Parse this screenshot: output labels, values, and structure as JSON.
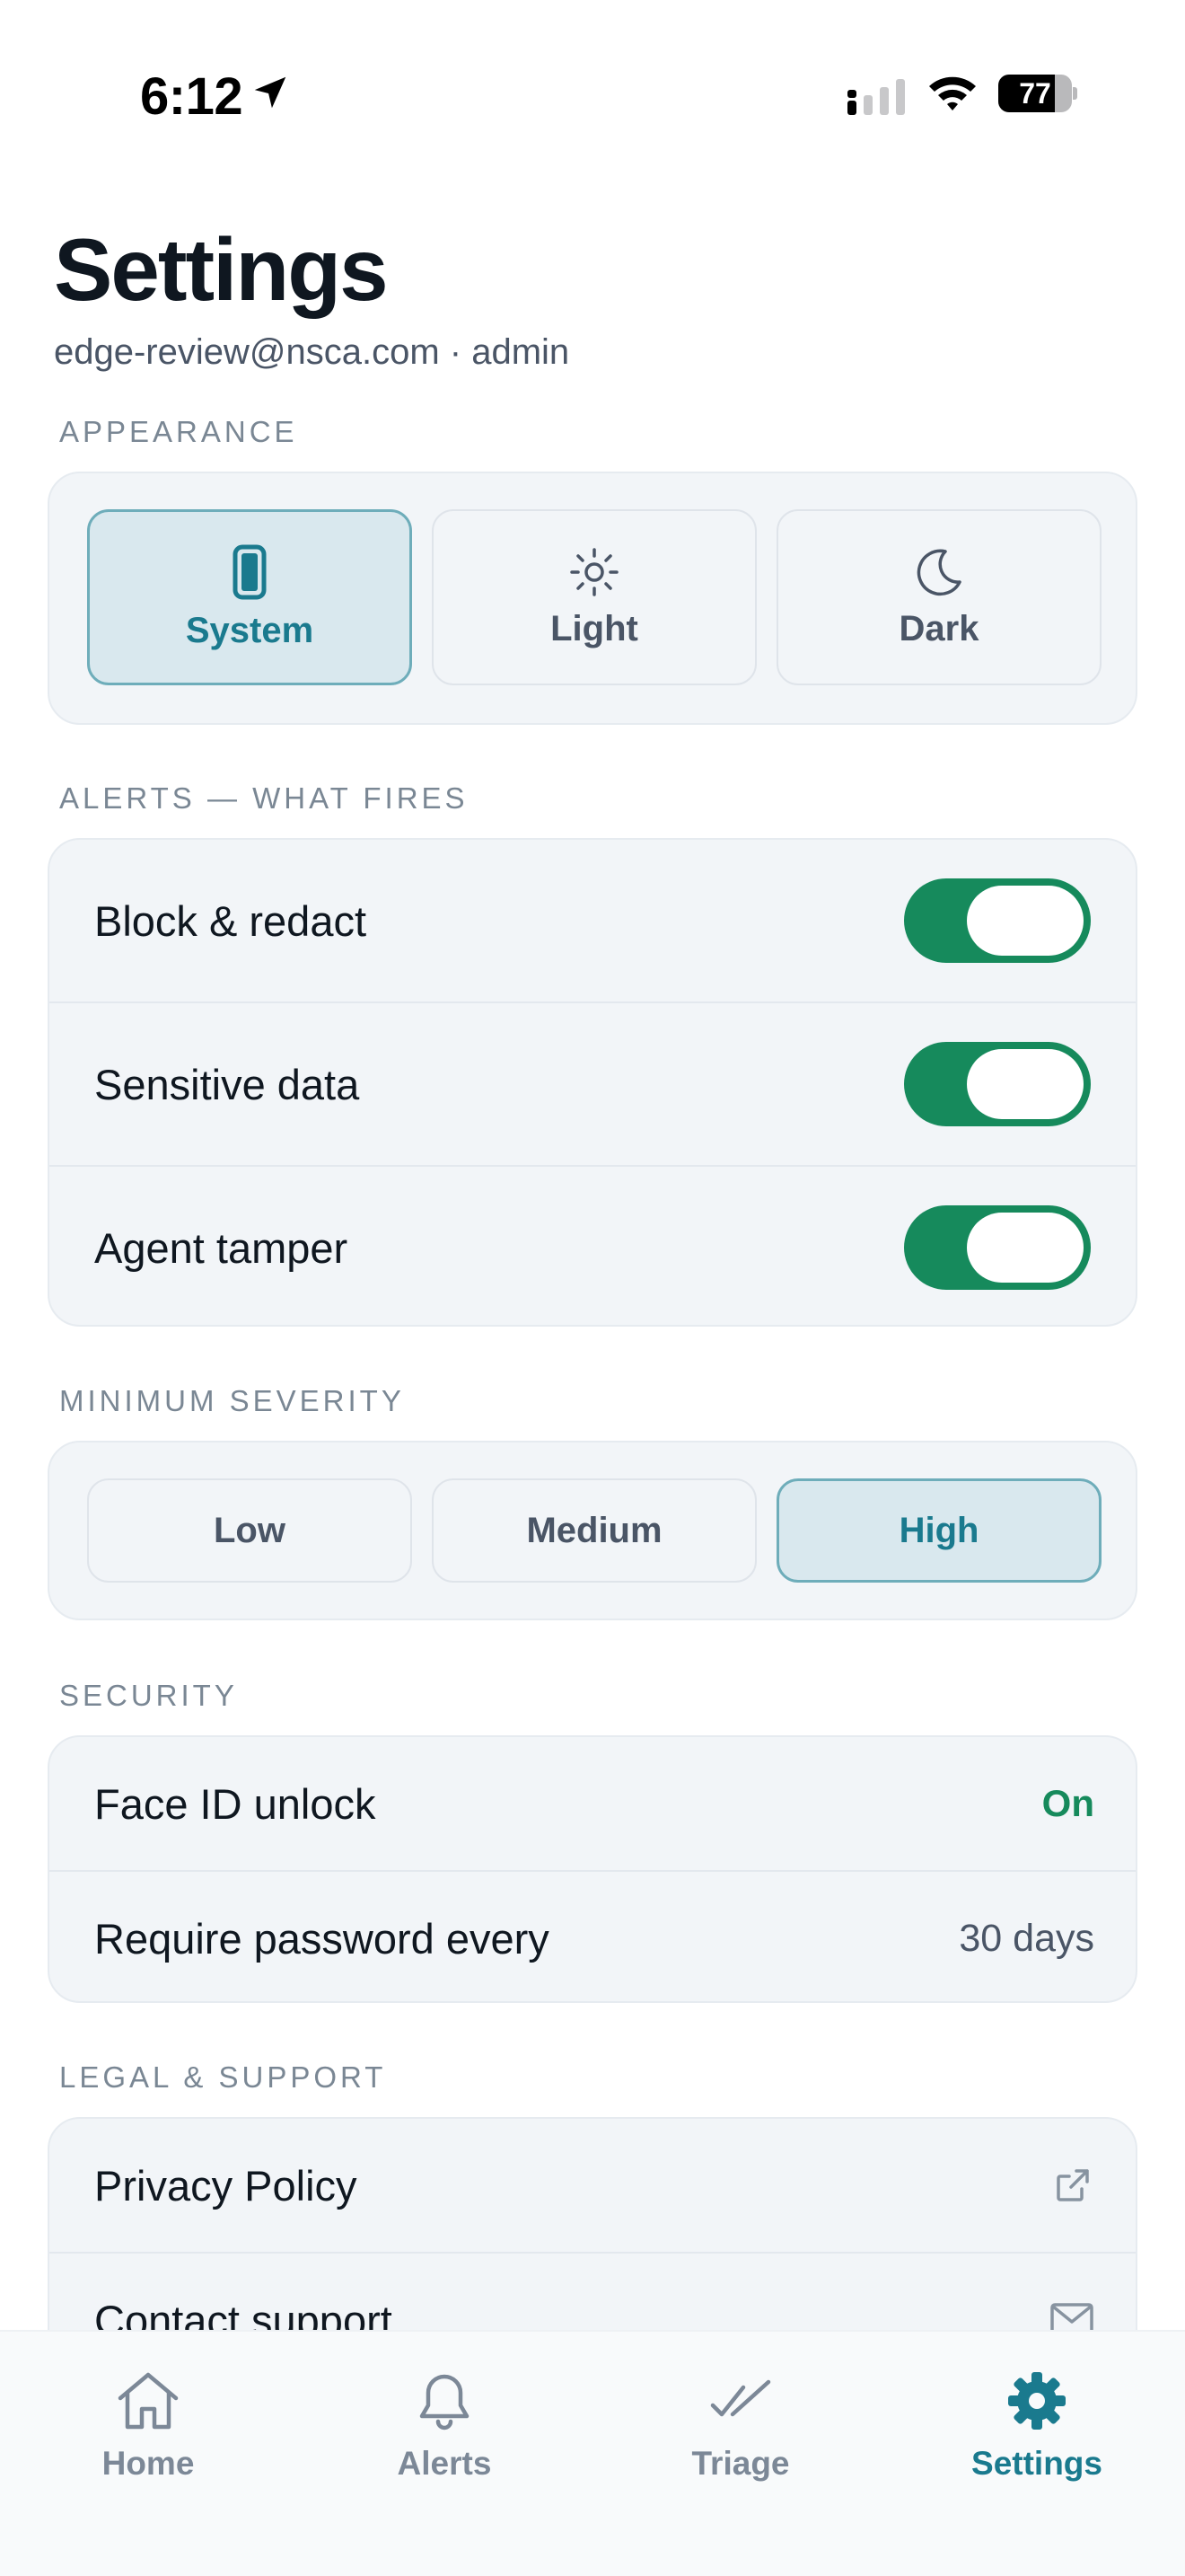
{
  "status_bar": {
    "time": "6:12",
    "battery_percent": "77",
    "battery_level": 0.77,
    "icons": [
      "location-arrow-icon",
      "signal-icon",
      "wifi-icon",
      "battery-icon"
    ]
  },
  "header": {
    "title": "Settings",
    "account": "edge-review@nsca.com · admin"
  },
  "appearance": {
    "label": "APPEARANCE",
    "options": [
      {
        "label": "System",
        "icon": "phone-icon",
        "selected": true
      },
      {
        "label": "Light",
        "icon": "sun-icon",
        "selected": false
      },
      {
        "label": "Dark",
        "icon": "moon-icon",
        "selected": false
      }
    ]
  },
  "alerts": {
    "label": "ALERTS — WHAT FIRES",
    "items": [
      {
        "label": "Block & redact",
        "enabled": true
      },
      {
        "label": "Sensitive data",
        "enabled": true
      },
      {
        "label": "Agent tamper",
        "enabled": true
      }
    ]
  },
  "severity": {
    "label": "MINIMUM SEVERITY",
    "options": [
      {
        "label": "Low",
        "selected": false
      },
      {
        "label": "Medium",
        "selected": false
      },
      {
        "label": "High",
        "selected": true
      }
    ]
  },
  "security": {
    "label": "SECURITY",
    "items": [
      {
        "label": "Face ID unlock",
        "value": "On"
      },
      {
        "label": "Require password every",
        "value": "30 days"
      }
    ]
  },
  "legal": {
    "label": "LEGAL & SUPPORT",
    "items": [
      {
        "label": "Privacy Policy",
        "icon": "external-link-icon"
      },
      {
        "label": "Contact support",
        "icon": "mail-icon"
      }
    ]
  },
  "tabs": [
    {
      "label": "Home",
      "icon": "home-icon",
      "active": false
    },
    {
      "label": "Alerts",
      "icon": "bell-icon",
      "active": false
    },
    {
      "label": "Triage",
      "icon": "double-check-icon",
      "active": false
    },
    {
      "label": "Settings",
      "icon": "gear-icon",
      "active": true
    }
  ],
  "colors": {
    "accent": "#1a7a8e",
    "toggle_on": "#168a5c",
    "selected_bg": "#d9e8ee",
    "card_bg": "#f2f5f8"
  }
}
